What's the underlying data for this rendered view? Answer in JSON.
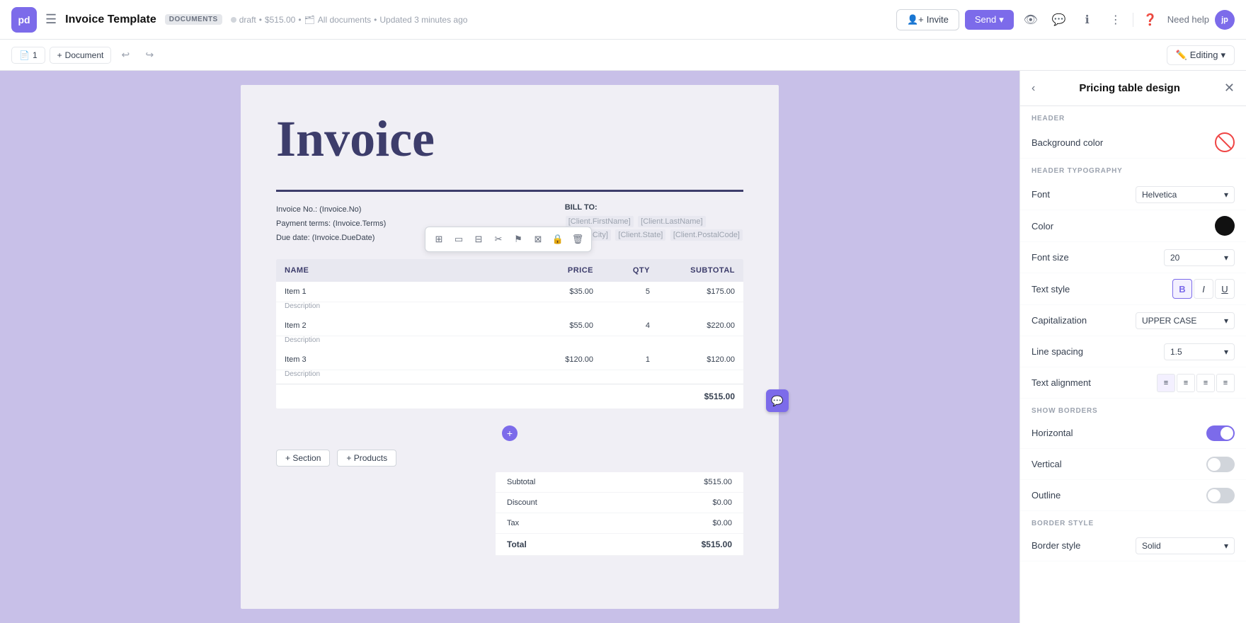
{
  "app": {
    "logo_text": "pd",
    "doc_title": "Invoice Template",
    "doc_badge": "DOCUMENTS",
    "doc_status": "draft",
    "doc_price": "$515.00",
    "doc_location": "All documents",
    "doc_updated": "Updated 3 minutes ago",
    "invite_btn": "Invite",
    "send_btn": "Send",
    "need_help": "Need help",
    "avatar": "jp"
  },
  "toolbar": {
    "pages_count": "1",
    "document_btn": "Document",
    "editing_btn": "Editing"
  },
  "document": {
    "invoice_title": "Invoice",
    "invoice_no": "Invoice No.: (Invoice.No)",
    "payment_terms": "Payment terms: (Invoice.Terms)",
    "due_date": "Due date: (Invoice.DueDate)",
    "bill_to_label": "BILL TO:",
    "client_firstname": "[Client.FirstName]",
    "client_lastname": "[Client.LastName]",
    "client_city": "[Client.City]",
    "client_state": "[Client.State]",
    "client_postal": "[Client.PostalCode]",
    "table_headers": [
      "NAME",
      "PRICE",
      "QTY",
      "SUBTOTAL"
    ],
    "rows": [
      {
        "name": "Item 1",
        "desc": "Description",
        "price": "$35.00",
        "qty": "5",
        "subtotal": "$175.00"
      },
      {
        "name": "Item 2",
        "desc": "Description",
        "price": "$55.00",
        "qty": "4",
        "subtotal": "$220.00"
      },
      {
        "name": "Item 3",
        "desc": "Description",
        "price": "$120.00",
        "qty": "1",
        "subtotal": "$120.00"
      }
    ],
    "total_row_value": "$515.00",
    "summary": {
      "subtotal_label": "Subtotal",
      "subtotal_value": "$515.00",
      "discount_label": "Discount",
      "discount_value": "$0.00",
      "tax_label": "Tax",
      "tax_value": "$0.00",
      "total_label": "Total",
      "total_value": "$515.00"
    },
    "add_section_btn": "+ Section",
    "add_products_btn": "+ Products"
  },
  "panel": {
    "title": "Pricing table design",
    "header_section_label": "HEADER",
    "bg_color_label": "Background color",
    "header_typography_label": "HEADER TYPOGRAPHY",
    "font_label": "Font",
    "font_value": "Helvetica",
    "color_label": "Color",
    "font_size_label": "Font size",
    "font_size_value": "20",
    "text_style_label": "Text style",
    "capitalization_label": "Capitalization",
    "capitalization_value": "UPPER CASE",
    "line_spacing_label": "Line spacing",
    "line_spacing_value": "1.5",
    "text_alignment_label": "Text alignment",
    "show_borders_label": "SHOW BORDERS",
    "horizontal_label": "Horizontal",
    "horizontal_on": true,
    "vertical_label": "Vertical",
    "vertical_on": false,
    "outline_label": "Outline",
    "outline_on": false,
    "border_style_section": "BORDER STYLE",
    "border_style_label": "Border style",
    "border_style_value": "Solid"
  }
}
